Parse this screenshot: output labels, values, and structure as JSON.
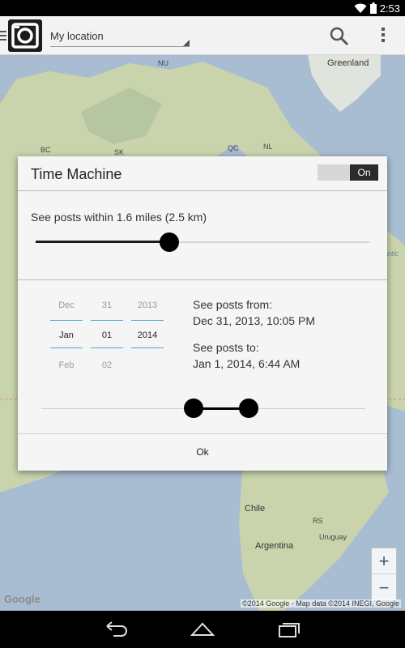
{
  "status_bar": {
    "time": "2:53",
    "icons": [
      "wifi-icon",
      "battery-icon"
    ]
  },
  "action_bar": {
    "location_label": "My location",
    "icons": [
      "menu-icon",
      "camera-logo-icon",
      "search-icon",
      "overflow-menu-icon"
    ]
  },
  "map": {
    "labels": {
      "nu": "NU",
      "greenland": "Greenland",
      "bc": "BC",
      "sk": "SK",
      "qc": "QC",
      "nl": "NL",
      "atlantic": "ntic",
      "chile": "Chile",
      "argentina": "Argentina",
      "uruguay": "Uruguay",
      "rs": "RS"
    },
    "zoom_in": "+",
    "zoom_out": "−",
    "google_logo": "Google",
    "attribution": "©2014 Google - Map data ©2014 INEGI, Google"
  },
  "dialog": {
    "title": "Time Machine",
    "toggle_label": "On",
    "toggle_state": "on",
    "radius_label": "See posts within 1.6 miles (2.5 km)",
    "radius_slider_fraction": 0.4,
    "date_picker": {
      "month": {
        "prev": "Dec",
        "current": "Jan",
        "next": "Feb"
      },
      "day": {
        "prev": "31",
        "current": "01",
        "next": "02"
      },
      "year": {
        "prev": "2013",
        "current": "2014",
        "next": ""
      }
    },
    "from_label": "See posts from:",
    "from_value": "Dec 31, 2013, 10:05 PM",
    "to_label": "See posts to:",
    "to_value": "Jan 1, 2014, 6:44 AM",
    "range_slider": {
      "start_fraction": 0.47,
      "end_fraction": 0.64
    },
    "ok_label": "Ok"
  },
  "nav_bar": {
    "icons": [
      "back-icon",
      "home-icon",
      "recent-apps-icon"
    ]
  },
  "colors": {
    "accent_line": "#4aa8d8",
    "dialog_bg": "#f5f5f5",
    "map_water": "#a9bdd2",
    "map_land": "#cfd7b0"
  }
}
